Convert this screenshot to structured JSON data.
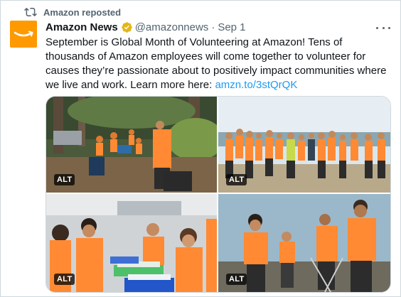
{
  "repost": {
    "label": "Amazon reposted",
    "icon": "repost-icon"
  },
  "author": {
    "display_name": "Amazon News",
    "handle": "@amazonnews",
    "separator": "·",
    "date": "Sep 1",
    "avatar_color": "#ff9900",
    "verified_color": "#e2b719"
  },
  "tweet": {
    "text": "September is Global Month of Volunteering at Amazon! Tens of thousands of Amazon employees will come together to volunteer for causes they’re passionate about to positively impact communities where we live and work. Learn more here: ",
    "link": "amzn.to/3stQrQK",
    "link_color": "#1d9bf0"
  },
  "media": {
    "images": [
      {
        "alt_badge": "ALT",
        "description_icon": "forest-volunteers-photo"
      },
      {
        "alt_badge": "ALT",
        "description_icon": "beach-group-photo"
      },
      {
        "alt_badge": "ALT",
        "description_icon": "packing-volunteers-photo"
      },
      {
        "alt_badge": "ALT",
        "description_icon": "shoreline-cleanup-photo"
      }
    ]
  },
  "more_menu": {
    "icon": "more-icon"
  }
}
